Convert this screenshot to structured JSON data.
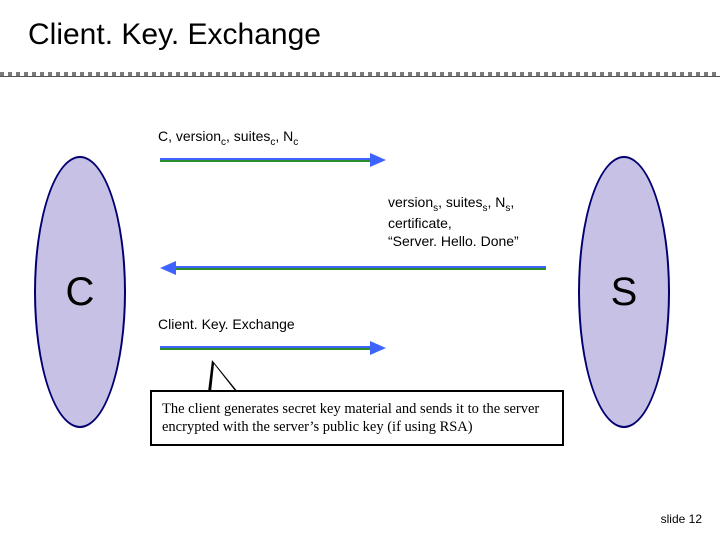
{
  "title": "Client. Key. Exchange",
  "client_label": "C",
  "server_label": "S",
  "messages": {
    "m1": "C, version<sub>c</sub>, suites<sub>c</sub>, N<sub>c</sub>",
    "m2": "version<sub>s</sub>, suites<sub>s</sub>, N<sub>s</sub>,<br>certificate,<br>“Server. Hello. Done”",
    "m3": "Client. Key. Exchange"
  },
  "callout": "The client generates secret key material and sends it to the server encrypted with the server’s public key (if using RSA)",
  "footer": "slide 12"
}
